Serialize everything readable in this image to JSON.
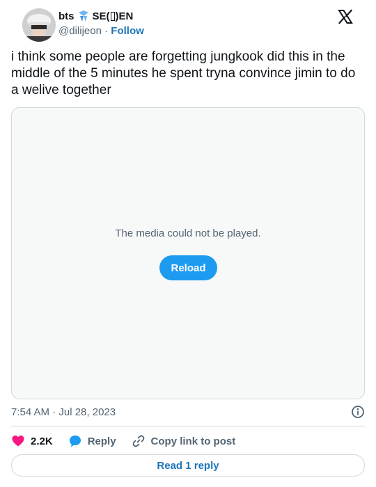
{
  "author": {
    "display_name_prefix": "bts",
    "display_name_suffix": "SE(",
    "display_name_end": ")EN",
    "handle": "@dilijeon",
    "separator": "·",
    "follow_label": "Follow"
  },
  "tweet": {
    "text": "i think some people are forgetting jungkook did this in the middle of the 5 minutes he spent tryna convince jimin to do a welive together"
  },
  "media": {
    "message": "The media could not be played.",
    "reload_label": "Reload"
  },
  "meta": {
    "timestamp": "7:54 AM · Jul 28, 2023"
  },
  "actions": {
    "likes": "2.2K",
    "reply_label": "Reply",
    "copy_link_label": "Copy link to post"
  },
  "footer": {
    "read_replies_label": "Read 1 reply"
  },
  "colors": {
    "accent": "#1d9bf0",
    "link": "#1d74b9",
    "like": "#f91880",
    "muted": "#536471"
  },
  "icons": [
    "x-logo-icon",
    "info-icon",
    "heart-icon",
    "reply-bubble-icon",
    "link-icon",
    "ribbon-emoji-icon"
  ]
}
